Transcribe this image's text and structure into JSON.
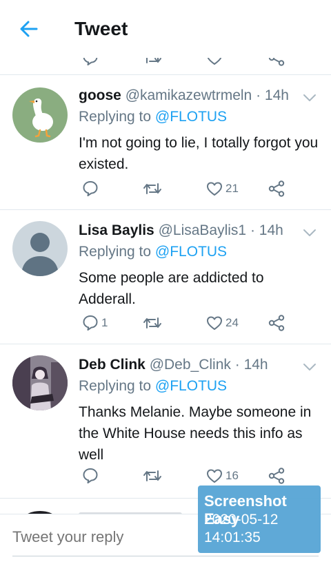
{
  "header": {
    "title": "Tweet",
    "back_icon": "arrow-left-icon",
    "accent": "#1da1f2"
  },
  "tweets": [
    {
      "name": "goose",
      "handle": "@kamikazewtrmeln",
      "time": "· 14h",
      "reply_prefix": "Replying to ",
      "reply_to": "@FLOTUS",
      "text": "I'm not going to lie, I totally forgot you existed.",
      "replies": "",
      "retweets": "",
      "likes": "21",
      "avatar": "goose-avatar"
    },
    {
      "name": "Lisa Baylis",
      "handle": "@LisaBaylis1",
      "time": "· 14h",
      "reply_prefix": "Replying to ",
      "reply_to": "@FLOTUS",
      "text": "Some people are addicted to Adderall.",
      "replies": "1",
      "retweets": "",
      "likes": "24",
      "avatar": "default-avatar"
    },
    {
      "name": "Deb Clink",
      "handle": "@Deb_Clink",
      "time": "· 14h",
      "reply_prefix": "Replying to ",
      "reply_to": "@FLOTUS",
      "text": "Thanks Melanie. Maybe someone in the White House needs this info as well",
      "replies": "",
      "retweets": "",
      "likes": "16",
      "avatar": "photo-avatar"
    }
  ],
  "reply_bar": {
    "placeholder": "Tweet your reply"
  },
  "watermark": {
    "title": "Screenshot Easy",
    "date": "2020-05-12",
    "time": "14:01:35"
  },
  "colors": {
    "secondary_text": "#657786",
    "mention": "#1da1f2",
    "divider": "#e1e8ed"
  }
}
